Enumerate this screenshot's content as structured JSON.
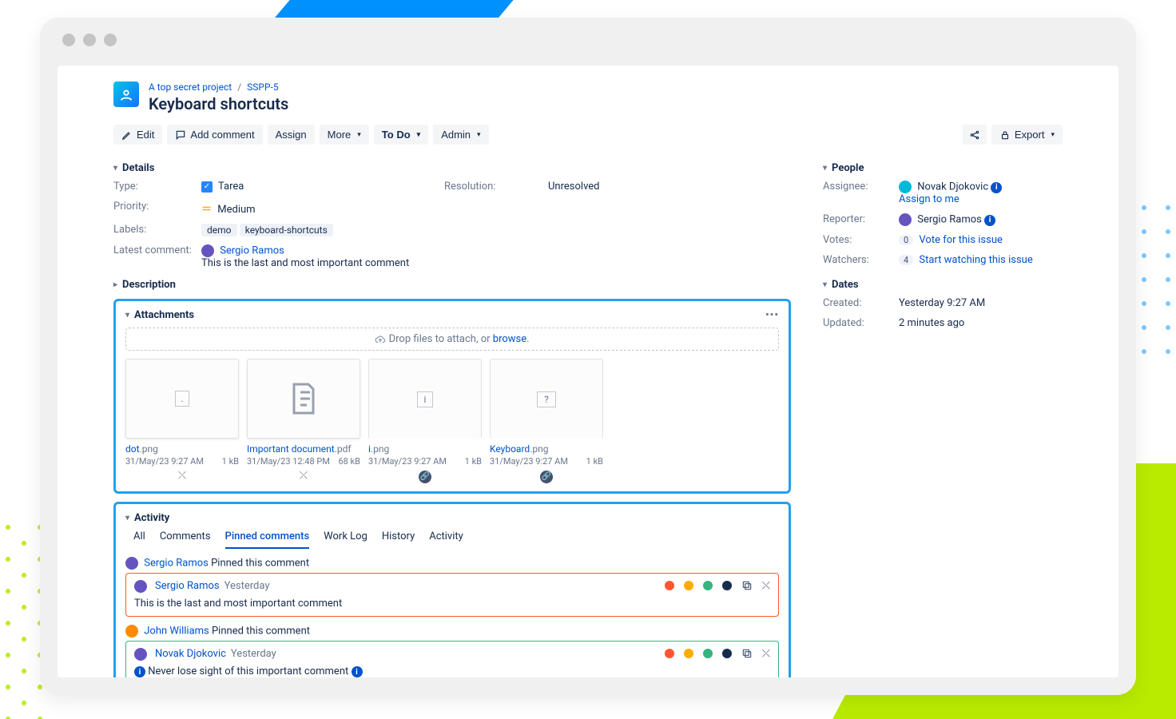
{
  "breadcrumb": {
    "project": "A top secret project",
    "key": "SSPP-5"
  },
  "issue_title": "Keyboard shortcuts",
  "toolbar": {
    "edit": "Edit",
    "add_comment": "Add comment",
    "assign": "Assign",
    "more": "More",
    "status": "To Do",
    "admin": "Admin",
    "export": "Export"
  },
  "sections": {
    "details": "Details",
    "description": "Description",
    "attachments": "Attachments",
    "activity": "Activity",
    "people": "People",
    "dates": "Dates"
  },
  "details": {
    "type_label": "Type:",
    "type_value": "Tarea",
    "resolution_label": "Resolution:",
    "resolution_value": "Unresolved",
    "priority_label": "Priority:",
    "priority_value": "Medium",
    "labels_label": "Labels:",
    "labels": {
      "0": "demo",
      "1": "keyboard-shortcuts"
    },
    "latest_label": "Latest comment:",
    "latest_user": "Sergio Ramos",
    "latest_text": "This is the last and most important comment"
  },
  "attachments": {
    "drop_text": "Drop files to attach, or ",
    "browse": "browse",
    "items": {
      "0": {
        "name": "dot",
        "ext": ".png",
        "date": "31/May/23 9:27 AM",
        "size": "1 kB"
      },
      "1": {
        "name": "Important document",
        "ext": ".pdf",
        "date": "31/May/23 12:48 PM",
        "size": "68 kB"
      },
      "2": {
        "name": "i",
        "ext": ".png",
        "date": "31/May/23 9:27 AM",
        "size": "1 kB"
      },
      "3": {
        "name": "Keyboard",
        "ext": ".png",
        "date": "31/May/23 9:27 AM",
        "size": "1 kB"
      }
    }
  },
  "activity": {
    "tabs": {
      "all": "All",
      "comments": "Comments",
      "pinned": "Pinned comments",
      "worklog": "Work Log",
      "history": "History",
      "activity": "Activity"
    },
    "pinned_suffix": "Pinned this comment",
    "c1": {
      "pinner": "Sergio Ramos",
      "author": "Sergio Ramos",
      "time": "Yesterday",
      "body": "This is the last and most important comment"
    },
    "c2": {
      "pinner": "John Williams",
      "author": "Novak Djokovic",
      "time": "Yesterday",
      "body": "Never lose sight of this important comment"
    }
  },
  "people": {
    "assignee_label": "Assignee:",
    "assignee": "Novak Djokovic",
    "assign_to_me": "Assign to me",
    "reporter_label": "Reporter:",
    "reporter": "Sergio Ramos",
    "votes_label": "Votes:",
    "votes_count": "0",
    "vote_link": "Vote for this issue",
    "watchers_label": "Watchers:",
    "watchers_count": "4",
    "watch_link": "Start watching this issue"
  },
  "dates": {
    "created_label": "Created:",
    "created": "Yesterday 9:27 AM",
    "updated_label": "Updated:",
    "updated": "2 minutes ago"
  },
  "glyph": {
    "dot": ".",
    "i": "i",
    "q": "?"
  }
}
